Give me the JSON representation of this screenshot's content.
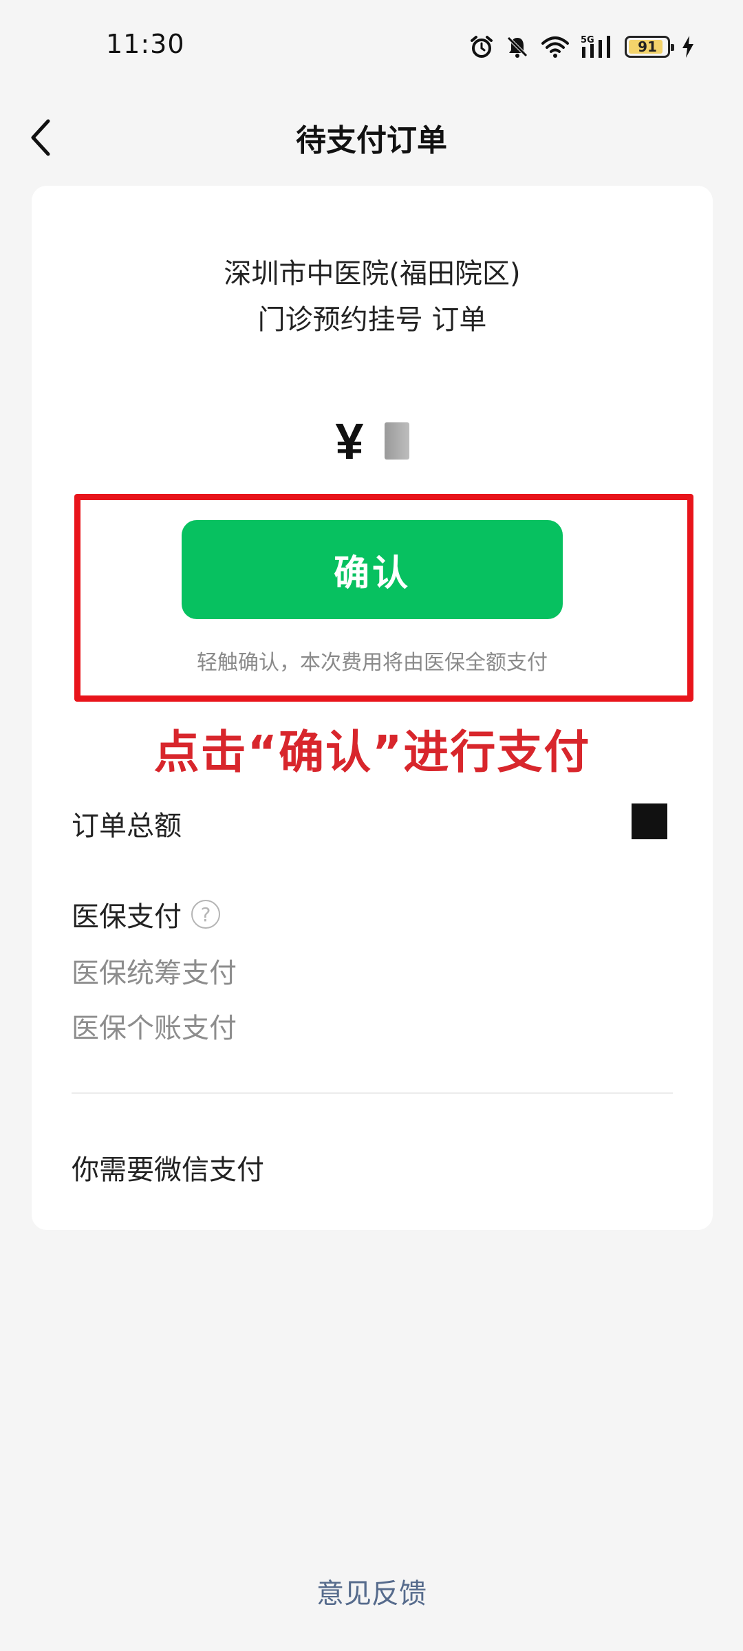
{
  "status_bar": {
    "time": "11:30",
    "battery_level": "91",
    "battery_fraction": 0.91,
    "network": "5G",
    "icons": [
      "alarm-icon",
      "mute-bell-icon",
      "wifi-icon",
      "signal-icon",
      "battery-icon",
      "charging-icon"
    ]
  },
  "nav": {
    "title": "待支付订单",
    "back_icon": "chevron-left-icon"
  },
  "order": {
    "hospital": "深圳市中医院(福田院区)",
    "type": "门诊预约挂号 订单",
    "currency_symbol": "¥"
  },
  "confirm": {
    "button_label": "确认",
    "hint": "轻触确认，本次费用将由医保全额支付",
    "button_color": "#07c160"
  },
  "annotation": {
    "text": "点击“确认”进行支付",
    "color": "#d8262c",
    "box_color": "#e8141b"
  },
  "details": {
    "total_label": "订单总额",
    "medical_label": "医保支付",
    "help_icon": "?",
    "pool_label": "医保统筹支付",
    "personal_label": "医保个账支付",
    "wechat_label": "你需要微信支付"
  },
  "footer": {
    "feedback": "意见反馈"
  }
}
